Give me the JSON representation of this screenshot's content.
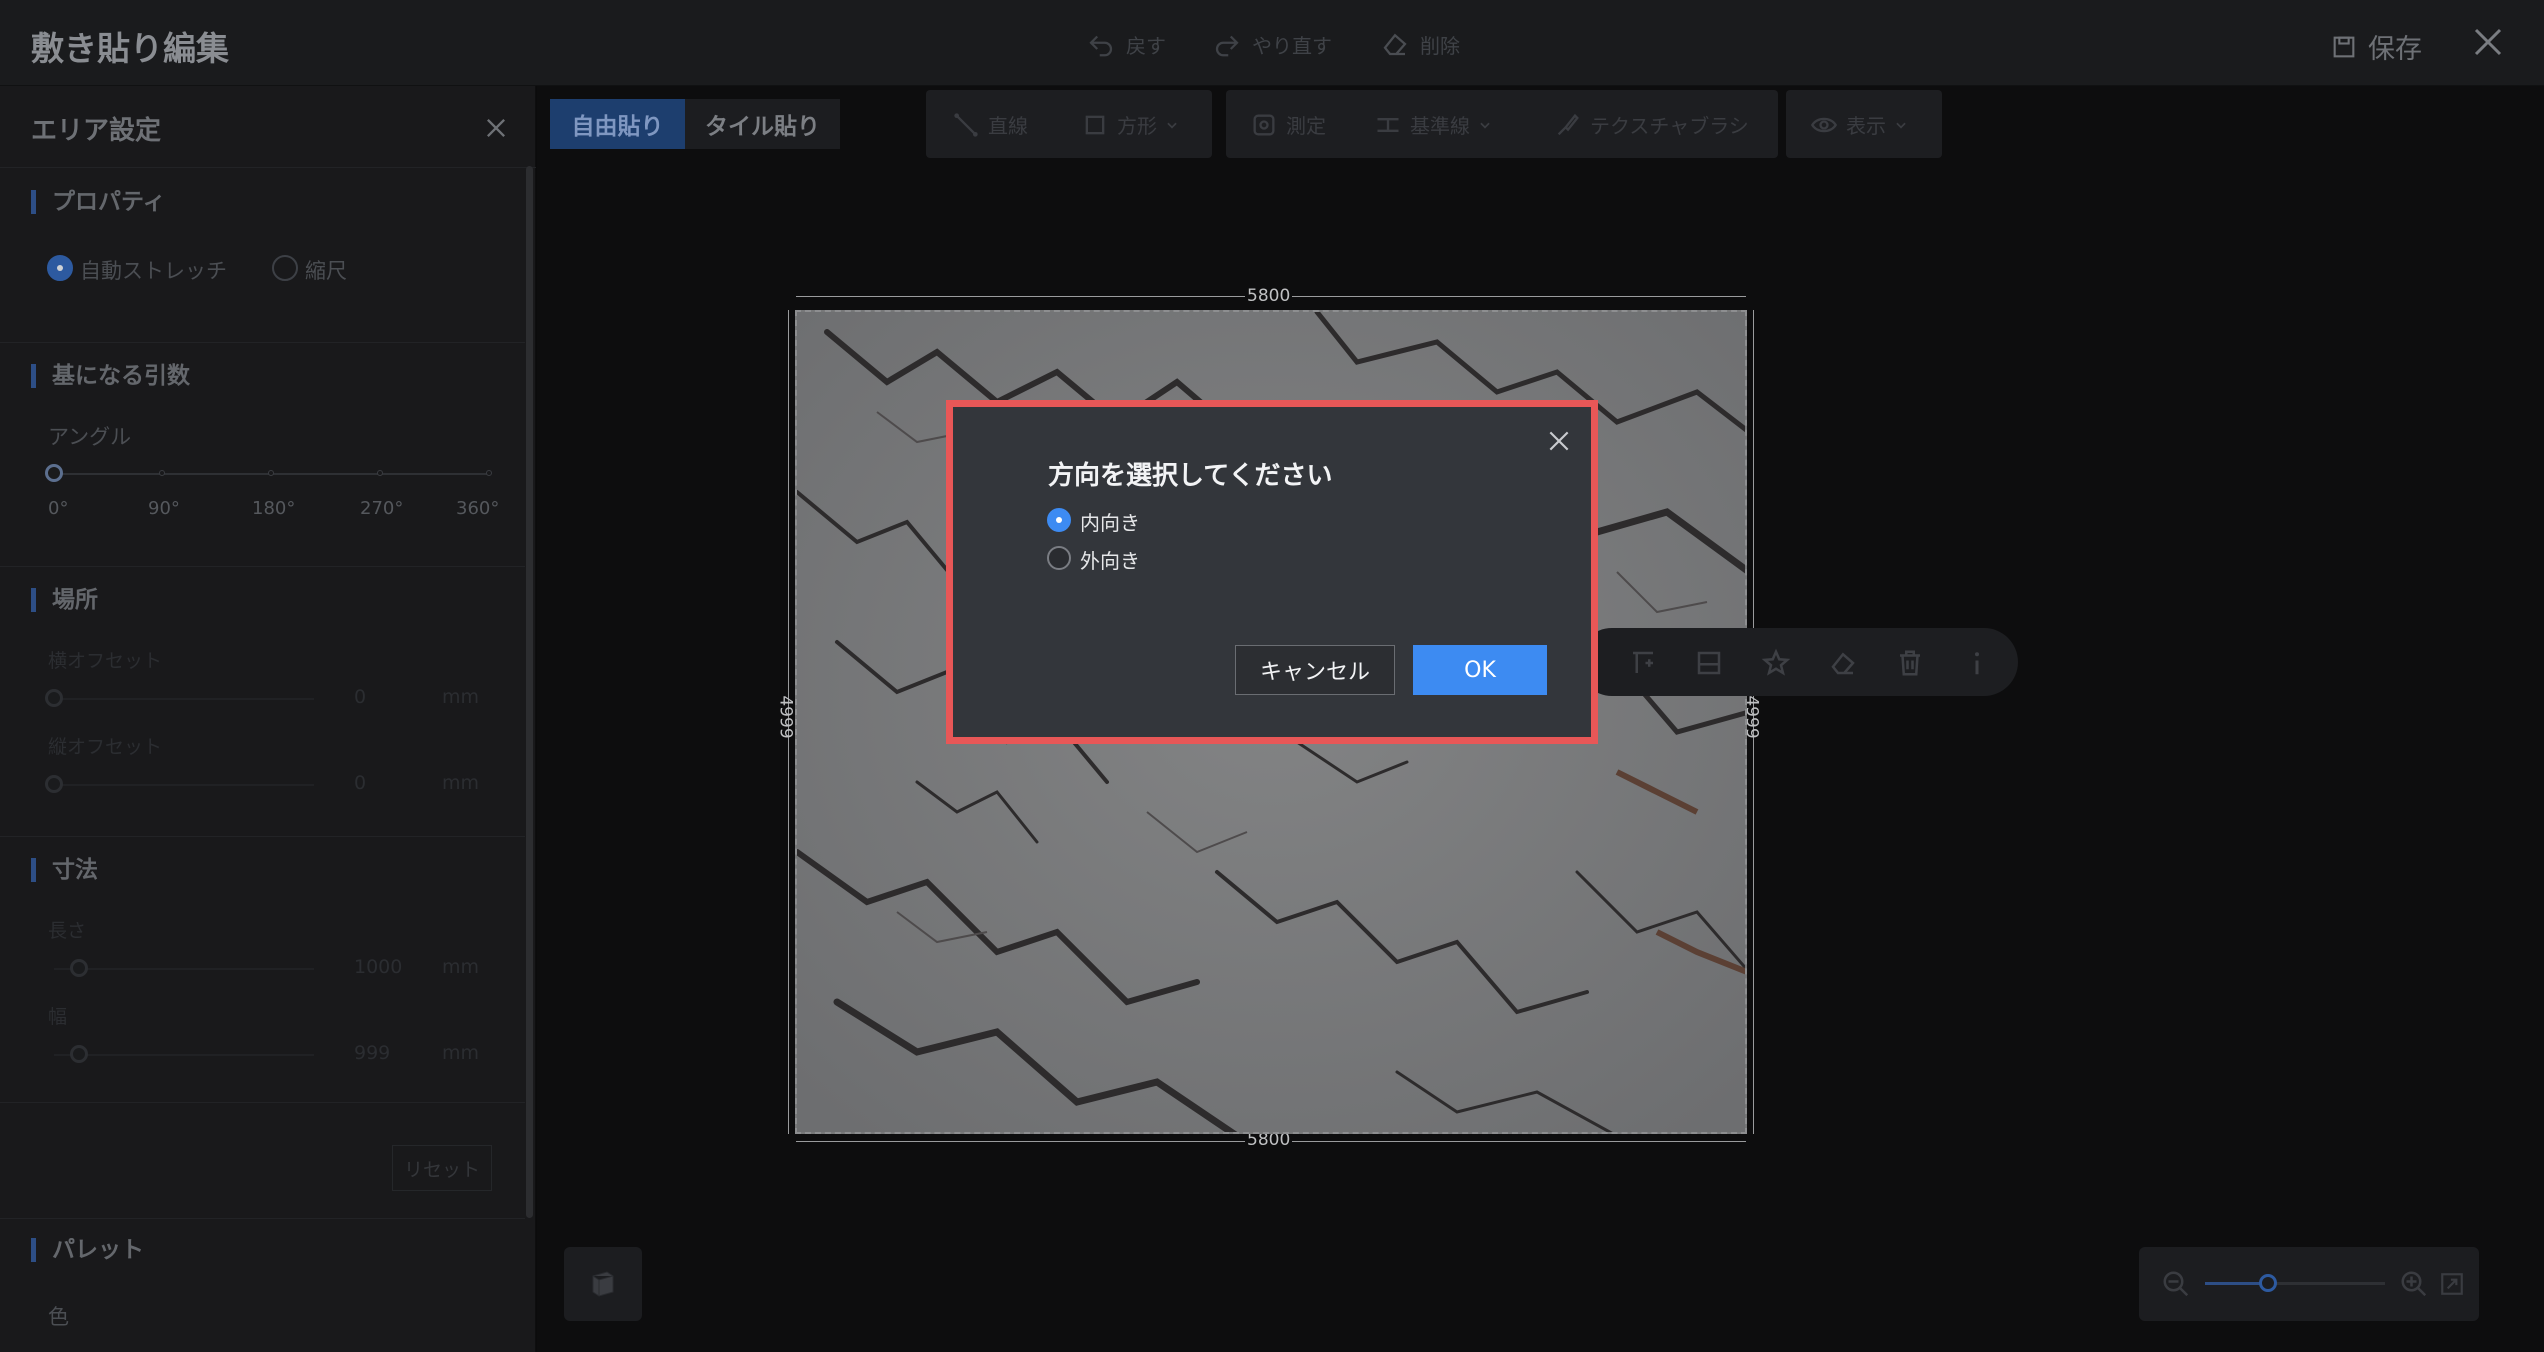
{
  "app": {
    "title": "敷き貼り編集"
  },
  "titlebar": {
    "undo_label": "戻す",
    "redo_label": "やり直す",
    "delete_label": "削除",
    "save_label": "保存"
  },
  "left_panel": {
    "title": "エリア設定",
    "properties": {
      "title": "プロパティ",
      "options": [
        "自動ストレッチ",
        "縮尺"
      ],
      "selected": "自動ストレッチ"
    },
    "base_params": {
      "title": "基になる引数",
      "angle_label": "アングル",
      "angle_ticks": [
        "0°",
        "90°",
        "180°",
        "270°",
        "360°"
      ],
      "angle_value": 0
    },
    "location": {
      "title": "場所",
      "h_offset_label": "横オフセット",
      "h_offset_value": "0",
      "v_offset_label": "縦オフセット",
      "v_offset_value": "0",
      "unit": "mm"
    },
    "dimensions": {
      "title": "寸法",
      "length_label": "長さ",
      "length_value": "1000",
      "width_label": "幅",
      "width_value": "999",
      "unit": "mm"
    },
    "reset_label": "リセット",
    "palette": {
      "title": "パレット",
      "color_label": "色"
    }
  },
  "mode_tabs": {
    "free": "自由貼り",
    "tile": "タイル貼り",
    "active": "free"
  },
  "tools": {
    "line": "直線",
    "rect": "方形",
    "measure": "測定",
    "guide": "基準線",
    "texture_brush": "テクスチャブラシ",
    "view": "表示"
  },
  "floor": {
    "top_dim": "5800",
    "bottom_dim": "5800",
    "left_dim": "4999",
    "right_dim": "4999"
  },
  "dialog": {
    "title": "方向を選択してください",
    "options": [
      "内向き",
      "外向き"
    ],
    "selected": "内向き",
    "cancel_label": "キャンセル",
    "ok_label": "OK"
  },
  "colors": {
    "accent": "#3d8bf2",
    "highlight": "#e85757",
    "dialog_bg": "#33363b"
  },
  "zoom": {
    "level": 0.35
  }
}
